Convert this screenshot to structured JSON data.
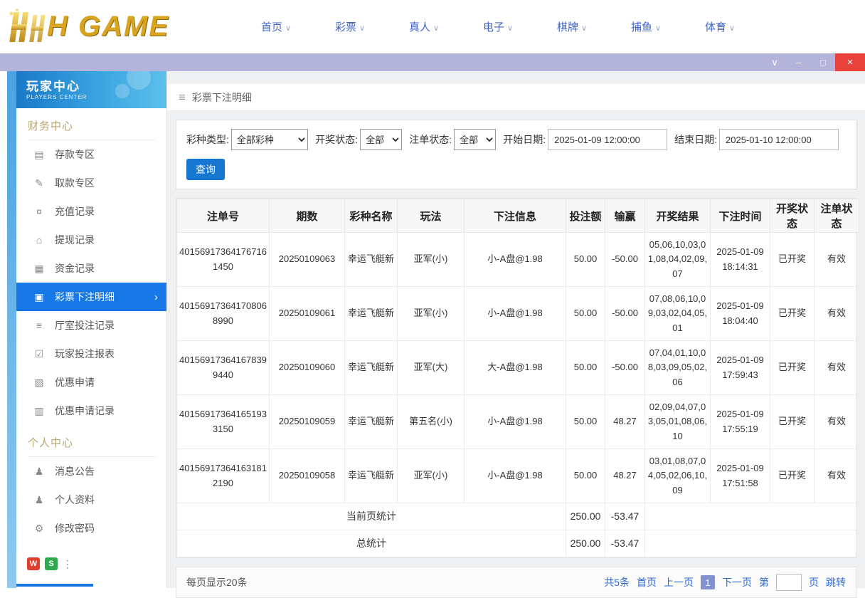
{
  "logo": {
    "text": "H GAME"
  },
  "top_nav": {
    "items": [
      {
        "label": "首页"
      },
      {
        "label": "彩票"
      },
      {
        "label": "真人"
      },
      {
        "label": "电子"
      },
      {
        "label": "棋牌"
      },
      {
        "label": "捕鱼"
      },
      {
        "label": "体育"
      }
    ]
  },
  "sidebar": {
    "title": "玩家中心",
    "subtitle": "PLAYERS CENTER",
    "sections": [
      {
        "label": "财务中心",
        "items": [
          {
            "label": "存款专区",
            "icon": "deposit",
            "active": false
          },
          {
            "label": "取款专区",
            "icon": "withdraw",
            "active": false
          },
          {
            "label": "充值记录",
            "icon": "recharge",
            "active": false
          },
          {
            "label": "提现记录",
            "icon": "cashout",
            "active": false
          },
          {
            "label": "资金记录",
            "icon": "funds",
            "active": false
          },
          {
            "label": "彩票下注明细",
            "icon": "lottery",
            "active": true
          },
          {
            "label": "厅室投注记录",
            "icon": "hall",
            "active": false
          },
          {
            "label": "玩家投注报表",
            "icon": "report",
            "active": false
          },
          {
            "label": "优惠申请",
            "icon": "promo",
            "active": false
          },
          {
            "label": "优惠申请记录",
            "icon": "promo-record",
            "active": false
          }
        ]
      },
      {
        "label": "个人中心",
        "items": [
          {
            "label": "消息公告",
            "icon": "message",
            "active": false
          },
          {
            "label": "个人资料",
            "icon": "profile",
            "active": false
          },
          {
            "label": "修改密码",
            "icon": "password",
            "active": false
          }
        ]
      }
    ]
  },
  "breadcrumb": {
    "title": "彩票下注明细"
  },
  "filters": {
    "lottery_type_label": "彩种类型:",
    "lottery_type_value": "全部彩种",
    "draw_status_label": "开奖状态:",
    "draw_status_value": "全部",
    "bet_status_label": "注单状态:",
    "bet_status_value": "全部",
    "start_date_label": "开始日期:",
    "start_date_value": "2025-01-09 12:00:00",
    "end_date_label": "结束日期:",
    "end_date_value": "2025-01-10 12:00:00",
    "search_button": "查询"
  },
  "table": {
    "headers": [
      "注单号",
      "期数",
      "彩种名称",
      "玩法",
      "下注信息",
      "投注额",
      "输赢",
      "开奖结果",
      "下注时间",
      "开奖状态",
      "注单状态"
    ],
    "rows": [
      {
        "id": "401569173641767161450",
        "period": "20250109063",
        "name": "幸运飞艇新",
        "play": "亚军(小)",
        "info": "小-A盘@1.98",
        "amount": "50.00",
        "winloss": "-50.00",
        "result": "05,06,10,03,01,08,04,02,09,07",
        "time": "2025-01-09 18:14:31",
        "draw_status": "已开奖",
        "status": "有效"
      },
      {
        "id": "401569173641708068990",
        "period": "20250109061",
        "name": "幸运飞艇新",
        "play": "亚军(小)",
        "info": "小-A盘@1.98",
        "amount": "50.00",
        "winloss": "-50.00",
        "result": "07,08,06,10,09,03,02,04,05,01",
        "time": "2025-01-09 18:04:40",
        "draw_status": "已开奖",
        "status": "有效"
      },
      {
        "id": "401569173641678399440",
        "period": "20250109060",
        "name": "幸运飞艇新",
        "play": "亚军(大)",
        "info": "大-A盘@1.98",
        "amount": "50.00",
        "winloss": "-50.00",
        "result": "07,04,01,10,08,03,09,05,02,06",
        "time": "2025-01-09 17:59:43",
        "draw_status": "已开奖",
        "status": "有效"
      },
      {
        "id": "401569173641651933150",
        "period": "20250109059",
        "name": "幸运飞艇新",
        "play": "第五名(小)",
        "info": "小-A盘@1.98",
        "amount": "50.00",
        "winloss": "48.27",
        "result": "02,09,04,07,03,05,01,08,06,10",
        "time": "2025-01-09 17:55:19",
        "draw_status": "已开奖",
        "status": "有效"
      },
      {
        "id": "401569173641631812190",
        "period": "20250109058",
        "name": "幸运飞艇新",
        "play": "亚军(小)",
        "info": "小-A盘@1.98",
        "amount": "50.00",
        "winloss": "48.27",
        "result": "03,01,08,07,04,05,02,06,10,09",
        "time": "2025-01-09 17:51:58",
        "draw_status": "已开奖",
        "status": "有效"
      }
    ],
    "page_summary": {
      "label": "当前页统计",
      "amount": "250.00",
      "winloss": "-53.47"
    },
    "total_summary": {
      "label": "总统计",
      "amount": "250.00",
      "winloss": "-53.47"
    }
  },
  "pagination": {
    "per_page": "每页显示20条",
    "total": "共5条",
    "first": "首页",
    "prev": "上一页",
    "current": "1",
    "next": "下一页",
    "jump_prefix": "第",
    "jump_suffix": "页",
    "jump_button": "跳转"
  }
}
